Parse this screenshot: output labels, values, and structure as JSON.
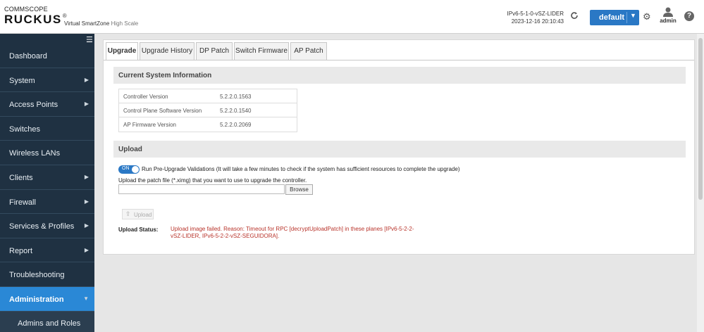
{
  "header": {
    "brand_top": "COMMSCOPE",
    "brand_main": "RUCKUS",
    "brand_reg": "®",
    "product": "Virtual SmartZone",
    "product_edition": "High Scale",
    "hostname": "IPv6-5-1-0-vSZ-LIDER",
    "datetime": "2023-12-16  20:10:43",
    "domain_label": "default",
    "user_label": "admin",
    "help_glyph": "?",
    "icons": {
      "refresh": "refresh-icon",
      "settings": "gear-icon",
      "user": "user-icon",
      "help": "help-icon"
    },
    "colors": {
      "accent": "#2a78c5"
    }
  },
  "sidebar": {
    "items": [
      {
        "label": "Dashboard",
        "has_arrow": false
      },
      {
        "label": "System",
        "has_arrow": true
      },
      {
        "label": "Access Points",
        "has_arrow": true
      },
      {
        "label": "Switches",
        "has_arrow": false
      },
      {
        "label": "Wireless LANs",
        "has_arrow": false
      },
      {
        "label": "Clients",
        "has_arrow": true
      },
      {
        "label": "Firewall",
        "has_arrow": true
      },
      {
        "label": "Services & Profiles",
        "has_arrow": true
      },
      {
        "label": "Report",
        "has_arrow": true
      },
      {
        "label": "Troubleshooting",
        "has_arrow": false
      },
      {
        "label": "Administration",
        "has_arrow": true,
        "active": true
      }
    ],
    "subitems": [
      {
        "label": "Admins and Roles"
      }
    ],
    "colors": {
      "background": "#1f3142",
      "active": "#2a88d6"
    }
  },
  "tabs": [
    {
      "label": "Upgrade",
      "active": true
    },
    {
      "label": "Upgrade History"
    },
    {
      "label": "DP Patch"
    },
    {
      "label": "Switch Firmware"
    },
    {
      "label": "AP Patch"
    }
  ],
  "system_info": {
    "title": "Current System Information",
    "rows": [
      {
        "label": "Controller Version",
        "value": "5.2.2.0.1563"
      },
      {
        "label": "Control Plane Software Version",
        "value": "5.2.2.0.1540"
      },
      {
        "label": "AP Firmware Version",
        "value": "5.2.2.0.2069"
      }
    ]
  },
  "upload": {
    "title": "Upload",
    "toggle_state": "ON",
    "toggle_label": "Run Pre-Upgrade Validations (It will take a few minutes to check if the system has sufficient resources to complete the upgrade)",
    "file_label": "Upload the patch file (*.ximg) that you want to use to upgrade the controller.",
    "file_value": "",
    "browse_label": "Browse",
    "upload_button_label": "Upload",
    "status_label": "Upload Status:",
    "status_message": "Upload image failed. Reason: Timeout for RPC [decryptUploadPatch] in these planes [IPv6-5-2-2-vSZ-LIDER, IPv6-5-2-2-vSZ-SEGUIDORA].",
    "colors": {
      "error": "#b8332a"
    }
  }
}
